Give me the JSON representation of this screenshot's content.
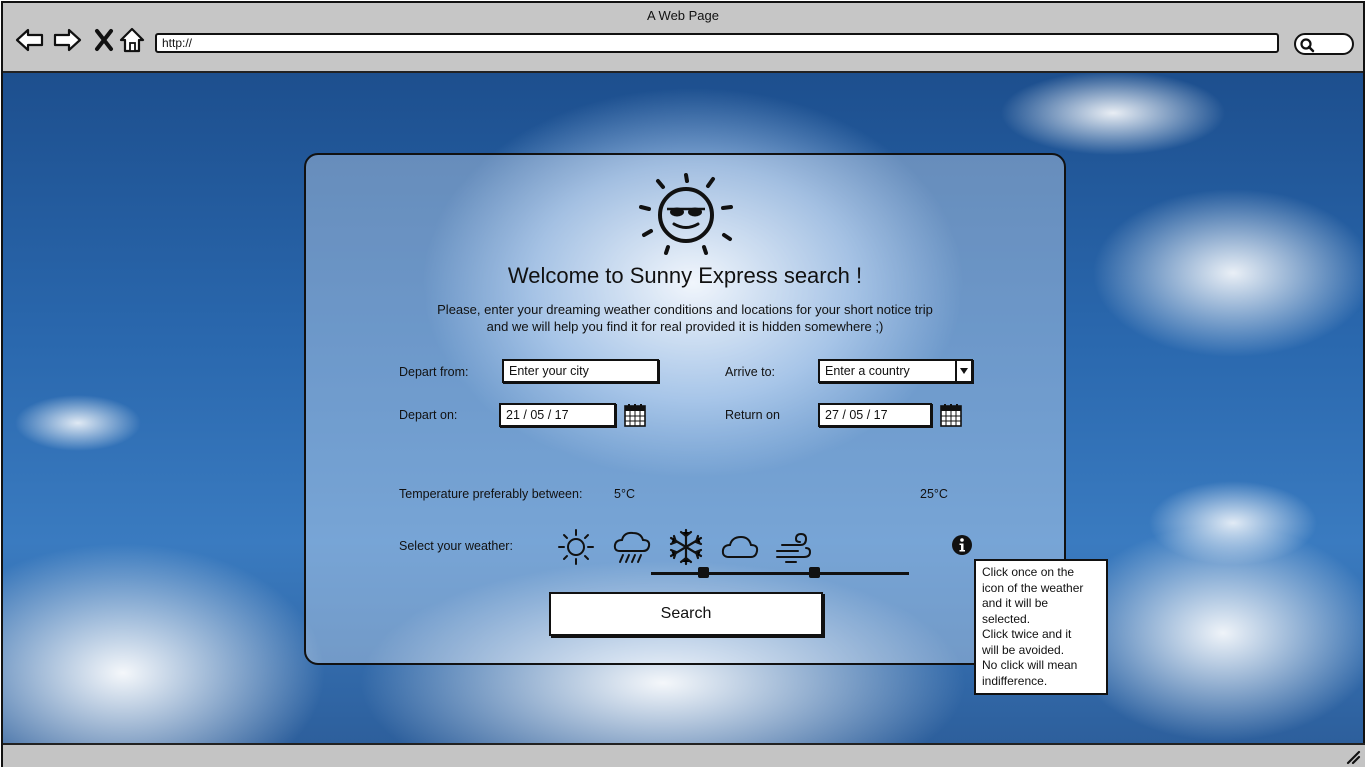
{
  "browser": {
    "title": "A Web Page",
    "url": "http://",
    "icons": [
      "back-arrow-icon",
      "forward-arrow-icon",
      "close-x-icon",
      "home-icon",
      "search-icon"
    ]
  },
  "form": {
    "welcome": "Welcome to Sunny Express search !",
    "intro_line1": "Please, enter your dreaming weather conditions and locations for your short notice trip",
    "intro_line2": "and we will help you find it for real provided it is hidden somewhere ;)",
    "depart_from": {
      "label": "Depart from:",
      "value": "Enter your city"
    },
    "arrive_to": {
      "label": "Arrive to:",
      "value": "Enter a country"
    },
    "depart_on": {
      "label": "Depart on:",
      "value": "21 / 05 / 17"
    },
    "return_on": {
      "label": "Return on",
      "value": "27 / 05 / 17"
    },
    "temperature": {
      "label": "Temperature preferably between:",
      "min_label": "5°C",
      "max_label": "25°C",
      "low_handle_fraction": 0.2,
      "high_handle_fraction": 0.63
    },
    "weather": {
      "label": "Select your weather:",
      "options": [
        "sun-icon",
        "rain-icon",
        "snowflake-icon",
        "cloud-icon",
        "wind-icon"
      ]
    },
    "search_button": "Search",
    "tooltip": "Click once on the\nicon of the weather\nand it will be\nselected.\nClick twice and it\nwill be avoided.\nNo click will mean\nindifference."
  }
}
